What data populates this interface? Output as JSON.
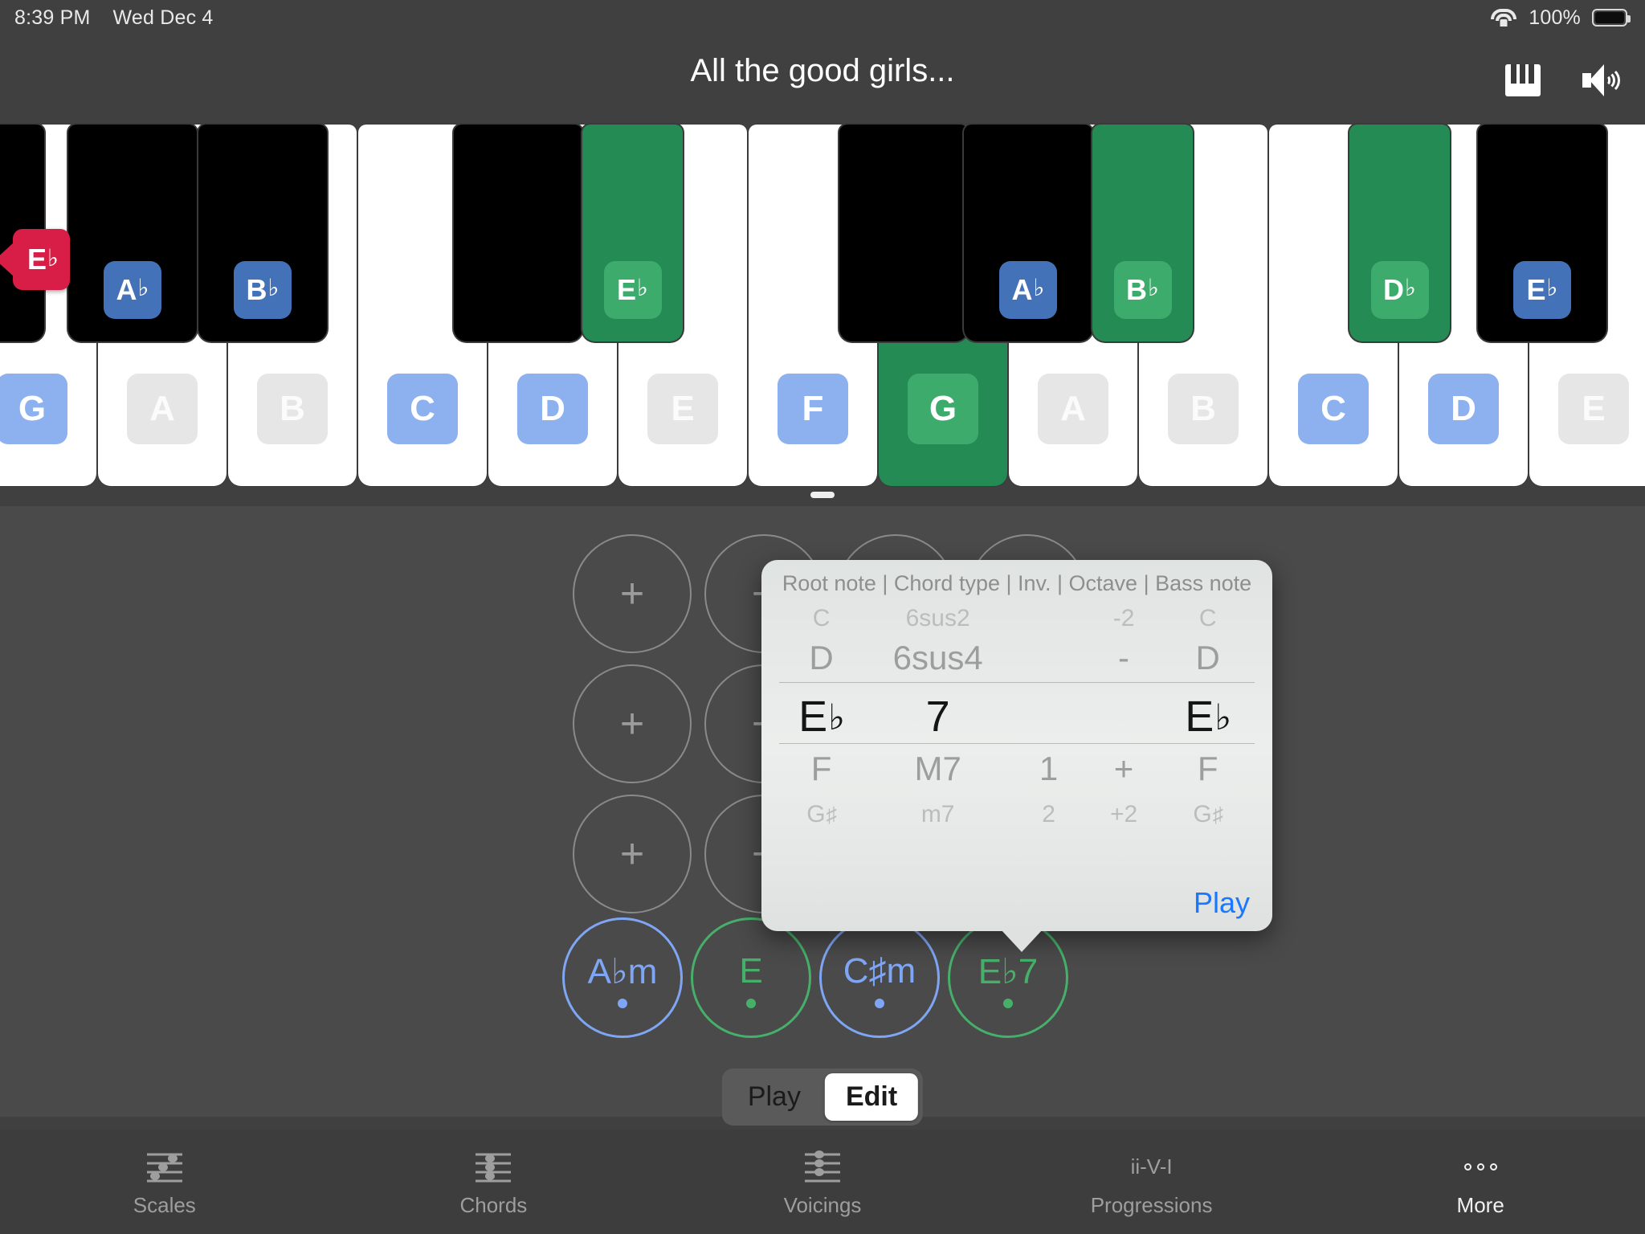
{
  "status_bar": {
    "time": "8:39 PM",
    "date": "Wed Dec 4",
    "battery_percent": "100%",
    "wifi_icon": "wifi-icon",
    "battery_icon": "battery-full-icon"
  },
  "header": {
    "title": "All the good girls...",
    "piano_icon": "piano-keys-icon",
    "volume_icon": "speaker-volume-icon"
  },
  "keyboard": {
    "root_badge": {
      "letter": "E",
      "accidental": "♭"
    },
    "white_keys": [
      {
        "label": "G",
        "style": "ltblue",
        "active": false
      },
      {
        "label": "A",
        "style": "grey",
        "active": false
      },
      {
        "label": "B",
        "style": "grey",
        "active": false
      },
      {
        "label": "C",
        "style": "ltblue",
        "active": false
      },
      {
        "label": "D",
        "style": "ltblue",
        "active": false
      },
      {
        "label": "E",
        "style": "grey",
        "active": false
      },
      {
        "label": "F",
        "style": "ltblue",
        "active": false
      },
      {
        "label": "G",
        "style": "green",
        "active": true
      },
      {
        "label": "A",
        "style": "grey",
        "active": false
      },
      {
        "label": "B",
        "style": "grey",
        "active": false
      },
      {
        "label": "C",
        "style": "ltblue",
        "active": false
      },
      {
        "label": "D",
        "style": "ltblue",
        "active": false
      },
      {
        "label": "E",
        "style": "grey",
        "active": false
      }
    ],
    "black_keys": [
      {
        "label": "",
        "accidental": "",
        "style": "none",
        "active": false
      },
      {
        "label": "A",
        "accidental": "♭",
        "style": "blue",
        "active": false
      },
      {
        "label": "B",
        "accidental": "♭",
        "style": "blue",
        "active": false
      },
      {
        "label": "",
        "accidental": "",
        "style": "none",
        "active": false
      },
      {
        "label": "E",
        "accidental": "♭",
        "style": "green",
        "active": true
      },
      {
        "label": "",
        "accidental": "",
        "style": "none",
        "active": false
      },
      {
        "label": "A",
        "accidental": "♭",
        "style": "blue",
        "active": false
      },
      {
        "label": "B",
        "accidental": "♭",
        "style": "green",
        "active": true
      },
      {
        "label": "D",
        "accidental": "♭",
        "style": "green",
        "active": true
      },
      {
        "label": "E",
        "accidental": "♭",
        "style": "blue",
        "active": false
      }
    ]
  },
  "progression": {
    "empty_slot_symbol": "+",
    "empty_slot_rows": 3,
    "empty_slot_cols": 4,
    "chords": [
      {
        "label": "A♭m",
        "color": "blue"
      },
      {
        "label": "E",
        "color": "green"
      },
      {
        "label": "C♯m",
        "color": "blue"
      },
      {
        "label": "E♭7",
        "color": "green"
      }
    ],
    "mode_segmented": {
      "options": [
        "Play",
        "Edit"
      ],
      "selected": "Edit"
    }
  },
  "popover": {
    "header": "Root note | Chord type | Inv. | Octave | Bass note",
    "play_label": "Play",
    "columns": [
      "Root note",
      "Chord type",
      "Inv.",
      "Octave",
      "Bass note"
    ],
    "rows": {
      "minus2": {
        "root": "C",
        "root_acc": "",
        "type": "6sus2",
        "inv": "",
        "oct": "-2",
        "bass": "C",
        "bass_acc": ""
      },
      "minus1": {
        "root": "D",
        "root_acc": "",
        "type": "6sus4",
        "inv": "",
        "oct": "-",
        "bass": "D",
        "bass_acc": ""
      },
      "selected": {
        "root": "E",
        "root_acc": "♭",
        "type": "7",
        "inv": "",
        "oct": "",
        "bass": "E",
        "bass_acc": "♭"
      },
      "plus1": {
        "root": "F",
        "root_acc": "",
        "type": "M7",
        "inv": "1",
        "oct": "+",
        "bass": "F",
        "bass_acc": ""
      },
      "plus2": {
        "root": "G",
        "root_acc": "♯",
        "type": "m7",
        "inv": "2",
        "oct": "+2",
        "bass": "G",
        "bass_acc": "♯"
      }
    }
  },
  "tabbar": {
    "items": [
      {
        "label": "Scales",
        "icon": "scales-staff-icon",
        "active": false
      },
      {
        "label": "Chords",
        "icon": "chords-staff-icon",
        "active": false
      },
      {
        "label": "Voicings",
        "icon": "voicings-staff-icon",
        "active": false
      },
      {
        "label": "Progressions",
        "icon": "ii-V-I-text-icon",
        "active": false,
        "icon_text": "ii-V-I"
      },
      {
        "label": "More",
        "icon": "ellipsis-icon",
        "active": true
      }
    ]
  },
  "colors": {
    "background": "#404040",
    "active_green": "#238B53",
    "badge_green": "#3cab6b",
    "badge_blue": "#4472b8",
    "badge_light_blue": "#8db0ee",
    "badge_grey": "#e6e6e6",
    "root_red": "#d81e46",
    "link_blue": "#1878ff"
  }
}
